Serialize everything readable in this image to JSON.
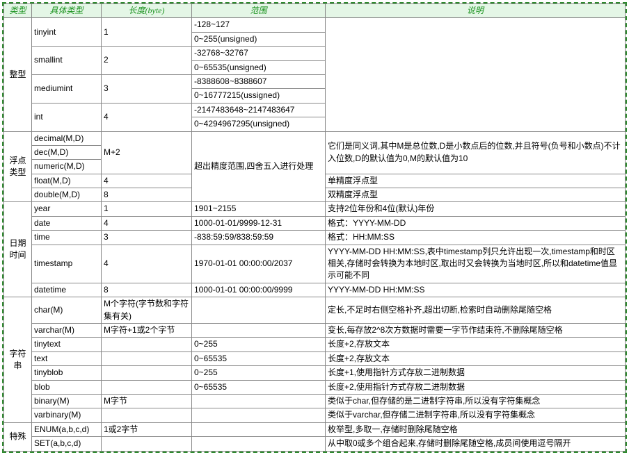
{
  "headers": [
    "类型",
    "具体类型",
    "长度(byte)",
    "范围",
    "说明"
  ],
  "cat": {
    "int": "整型",
    "float": "浮点类型",
    "date": "日期时间",
    "str": "字符串",
    "special": "特殊"
  },
  "t": {
    "tinyint": "tinyint",
    "smallint": "smallint",
    "mediumint": "mediumint",
    "int": "int",
    "decimal": "decimal(M,D)",
    "dec": "dec(M,D)",
    "numeric": "numeric(M,D)",
    "float": "float(M,D)",
    "double": "double(M,D)",
    "year": "year",
    "date": "date",
    "time": "time",
    "timestamp": "timestamp",
    "datetime": "datetime",
    "char": "char(M)",
    "varchar": "varchar(M)",
    "tinytext": "tinytext",
    "text": "text",
    "tinyblob": "tinyblob",
    "blob": "blob",
    "binary": "binary(M)",
    "varbinary": "varbinary(M)",
    "enum": "ENUM(a,b,c,d)",
    "set": "SET(a,b,c,d)"
  },
  "len": {
    "tinyint": "1",
    "smallint": "2",
    "mediumint": "3",
    "int": "4",
    "decimal": "M+2",
    "float": "4",
    "double": "8",
    "year": "1",
    "date": "4",
    "time": "3",
    "timestamp": "4",
    "datetime": "8",
    "char": "M个字符(字节数和字符集有关)",
    "varchar": "M字符+1或2个字节",
    "binary": "M字节",
    "enum": "1或2字节"
  },
  "rng": {
    "tinyint1": "-128~127",
    "tinyint2": "0~255(unsigned)",
    "smallint1": "-32768~32767",
    "smallint2": "0~65535(unsigned)",
    "mediumint1": "-8388608~8388607",
    "mediumint2": "0~16777215(ussigned)",
    "int1": "-2147483648~2147483647",
    "int2": "0~4294967295(unsigned)",
    "decimal": "超出精度范围,四舍五入进行处理",
    "year": "1901~2155",
    "date": "1000-01-01/9999-12-31",
    "time": "-838:59:59/838:59:59",
    "timestamp": "1970-01-01 00:00:00/2037",
    "datetime": "1000-01-01 00:00:00/9999",
    "tinytext": "0~255",
    "text": "0~65535",
    "tinyblob": "0~255",
    "blob": "0~65535"
  },
  "desc": {
    "decimal": "它们是同义词,其中M是总位数,D是小数点后的位数,并且符号(负号和小数点)不计入位数,D的默认值为0,M的默认值为10",
    "float": "单精度浮点型",
    "double": "双精度浮点型",
    "year": "支持2位年份和4位(默认)年份",
    "date": "格式：YYYY-MM-DD",
    "time": "格式：HH:MM:SS",
    "timestamp": "YYYY-MM-DD HH:MM:SS,表中timestamp列只允许出现一次,timestamp和时区相关,存储时会转换为本地时区,取出时又会转换为当地时区,所以和datetime值显示可能不同",
    "datetime": "YYYY-MM-DD HH:MM:SS",
    "char": "定长,不足时右侧空格补齐,超出切断,检索时自动删除尾随空格",
    "varchar": "变长,每存放2^8次方数据时需要一字节作结束符,不删除尾随空格",
    "tinytext": "长度+2,存放文本",
    "text": "长度+2,存放文本",
    "tinyblob": "长度+1,使用指针方式存放二进制数据",
    "blob": "长度+2,使用指针方式存放二进制数据",
    "binary": "类似于char,但存储的是二进制字符串,所以没有字符集概念",
    "varbinary": "类似于varchar,但存储二进制字符串,所以没有字符集概念",
    "enum": "枚举型,多取一,存储时删除尾随空格",
    "set": "从中取0或多个组合起来,存储时删除尾随空格,成员间使用逗号隔开"
  }
}
